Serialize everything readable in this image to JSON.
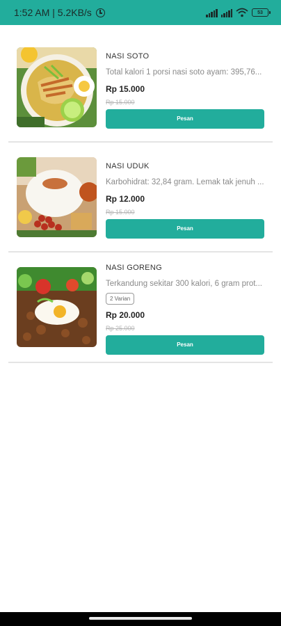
{
  "status_bar": {
    "time_speed": "1:52 AM | 5.2KB/s",
    "battery_level": "53",
    "icons": [
      "alarm-icon",
      "signal-icon",
      "signal-icon",
      "wifi-icon",
      "battery-icon"
    ]
  },
  "colors": {
    "accent": "#22ad9c",
    "divider": "#e4e4e4"
  },
  "menu": {
    "items": [
      {
        "name": "NASI SOTO",
        "description": "Total kalori 1 porsi nasi soto ayam: 395,76...",
        "price": "Rp 15.000",
        "old_price": "Rp 15.000",
        "button_label": "Pesan",
        "image": "nasi-soto-image"
      },
      {
        "name": "NASI UDUK",
        "description": "Karbohidrat: 32,84 gram. Lemak tak jenuh ...",
        "price": "Rp 12.000",
        "old_price": "Rp 15.000",
        "button_label": "Pesan",
        "image": "nasi-uduk-image"
      },
      {
        "name": "NASI GORENG",
        "description": "Terkandung sekitar 300 kalori, 6 gram prot...",
        "variant": "2 Varian",
        "price": "Rp 20.000",
        "old_price": "Rp 25.000",
        "button_label": "Pesan",
        "image": "nasi-goreng-image"
      }
    ]
  }
}
